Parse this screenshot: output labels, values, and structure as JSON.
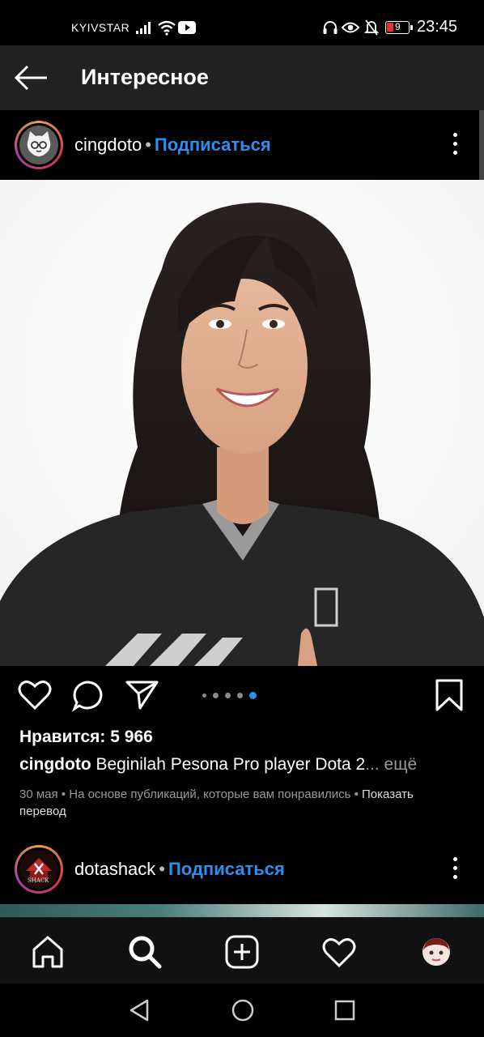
{
  "status_bar": {
    "carrier": "KYIVSTAR",
    "battery": "9",
    "time": "23:45",
    "icons": [
      "signal-icon",
      "wifi-icon",
      "youtube-icon",
      "headphones-icon",
      "eye-icon",
      "bell-off-icon",
      "battery-icon"
    ]
  },
  "header": {
    "title": "Интересное",
    "back_icon": "arrow-left-icon"
  },
  "post1": {
    "username": "cingdoto",
    "separator": "•",
    "follow_label": "Подписаться",
    "likes": "Нравится: 5 966",
    "caption_user": "cingdoto",
    "caption_text": "Beginilah Pesona Pro player Dota 2",
    "caption_more": "... ещё",
    "date": "30 мая",
    "reason": "На основе публикаций, которые вам понравились",
    "meta_separator": "•",
    "translate_label_1": "Показать",
    "translate_label_2": "перевод",
    "carousel": {
      "count": 5,
      "active_index": 4
    }
  },
  "post2": {
    "username": "dotashack",
    "separator": "•",
    "follow_label": "Подписаться",
    "avatar_text": "SHACK"
  },
  "bottom_nav": [
    "home-icon",
    "search-icon",
    "add-icon",
    "heart-icon",
    "profile-avatar"
  ],
  "system_nav": [
    "back-triangle-icon",
    "home-circle-icon",
    "recents-square-icon"
  ],
  "colors": {
    "background": "#000000",
    "appbar": "#222222",
    "accent_link": "#2d8ef0",
    "carousel_active": "#2d8ef0"
  }
}
